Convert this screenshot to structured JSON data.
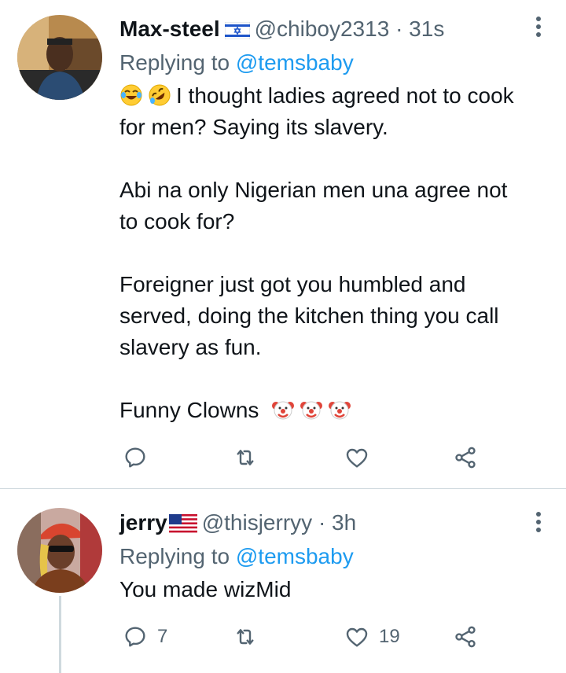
{
  "tweets": [
    {
      "name": "Max-steel",
      "flag": "israel-flag",
      "handle": "@chiboy2313",
      "separator": "·",
      "time": "31s",
      "replying_prefix": "Replying to",
      "replying_to": "@temsbaby",
      "paragraphs": [
        {
          "lead_emoji": [
            "face-with-tears-of-joy-emoji",
            "rolling-on-the-floor-laughing-emoji"
          ],
          "text": "I thought ladies agreed not to cook for men? Saying its slavery."
        },
        {
          "text": "Abi na only Nigerian men una agree not to cook for?"
        },
        {
          "text": "Foreigner just got you humbled and served, doing the kitchen thing you call slavery as fun."
        },
        {
          "text": "Funny Clowns",
          "trail_emoji": [
            "clown-face-emoji",
            "clown-face-emoji",
            "clown-face-emoji"
          ]
        }
      ],
      "actions": {
        "reply_count": "",
        "retweet_count": "",
        "like_count": ""
      },
      "icons": {
        "reply": "reply-icon",
        "retweet": "retweet-icon",
        "like": "heart-icon",
        "share": "share-icon",
        "more": "more-options-icon"
      }
    },
    {
      "name": "jerry",
      "flag": "usa-flag",
      "handle": "@thisjerryy",
      "separator": "·",
      "time": "3h",
      "replying_prefix": "Replying to",
      "replying_to": "@temsbaby",
      "paragraphs": [
        {
          "text": "You made wizMid"
        }
      ],
      "actions": {
        "reply_count": "7",
        "retweet_count": "",
        "like_count": "19"
      },
      "icons": {
        "reply": "reply-icon",
        "retweet": "retweet-icon",
        "like": "heart-icon",
        "share": "share-icon",
        "more": "more-options-icon"
      }
    }
  ],
  "colors": {
    "link": "#1d9bf0",
    "secondary_text": "#536471",
    "primary_text": "#0f1419",
    "divider": "#cfd9de"
  }
}
